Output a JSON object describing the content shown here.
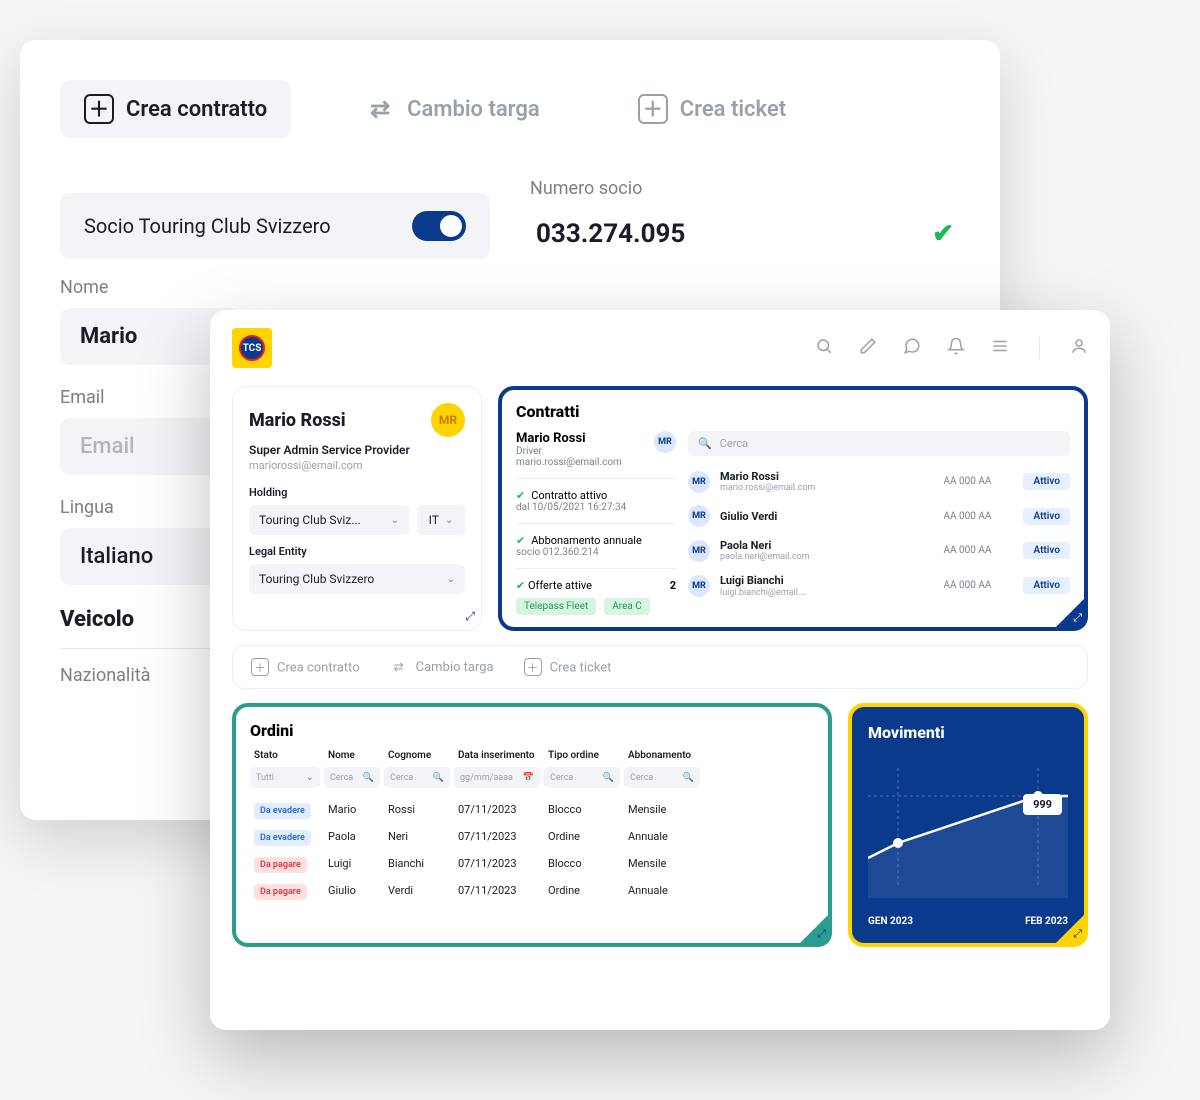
{
  "back": {
    "toolbar": {
      "create_contract": "Crea contratto",
      "change_plate": "Cambio targa",
      "create_ticket": "Crea ticket"
    },
    "member_label": "Socio Touring Club Svizzero",
    "number_label": "Numero socio",
    "number_value": "033.274.095",
    "name_label": "Nome",
    "name_value": "Mario",
    "email_label": "Email",
    "email_placeholder": "Email",
    "lang_label": "Lingua",
    "lang_value": "Italiano",
    "vehicle_heading": "Veicolo",
    "nationality_label": "Nazionalità"
  },
  "front": {
    "user": {
      "name": "Mario Rossi",
      "initials": "MR",
      "role": "Super Admin Service Provider",
      "email": "mariorossi@email.com",
      "holding_label": "Holding",
      "holding_value": "Touring Club Sviz...",
      "country": "IT",
      "legal_label": "Legal Entity",
      "legal_value": "Touring Club Svizzero"
    },
    "contracts": {
      "title": "Contratti",
      "driver_name": "Mario Rossi",
      "driver_role": "Driver",
      "driver_email": "mario.rossi@email.com",
      "status_active": "Contratto attivo",
      "status_date": "dal 10/05/2021 16:27:34",
      "sub_label": "Abbonamento annuale",
      "sub_socio": "socio 012.360.214",
      "offers_label": "Offerte attive",
      "offers_count": "2",
      "tag1": "Telepass Fleet",
      "tag2": "Area C",
      "search_placeholder": "Cerca",
      "people": [
        {
          "name": "Mario Rossi",
          "email": "mario.rossi@email.com",
          "code": "AA 000 AA",
          "status": "Attivo",
          "initials": "MR"
        },
        {
          "name": "Giulio Verdi",
          "email": "",
          "code": "AA 000 AA",
          "status": "Attivo",
          "initials": "MR"
        },
        {
          "name": "Paola Neri",
          "email": "paola.neri@email.com",
          "code": "AA 000 AA",
          "status": "Attivo",
          "initials": "MR"
        },
        {
          "name": "Luigi Bianchi",
          "email": "luigi.bianchi@email.…",
          "code": "AA 000 AA",
          "status": "Attivo",
          "initials": "MR"
        }
      ]
    },
    "actions": {
      "create_contract": "Crea contratto",
      "change_plate": "Cambio targa",
      "create_ticket": "Crea ticket"
    },
    "orders": {
      "title": "Ordini",
      "headers": {
        "stato": "Stato",
        "nome": "Nome",
        "cognome": "Cognome",
        "data": "Data inserimento",
        "tipo": "Tipo ordine",
        "abb": "Abbonamento"
      },
      "filters": {
        "tutti": "Tutti",
        "cerca": "Cerca",
        "date": "gg/mm/aaaa"
      },
      "rows": [
        {
          "status": "Da evadere",
          "status_cls": "blue",
          "nome": "Mario",
          "cognome": "Rossi",
          "data": "07/11/2023",
          "tipo": "Blocco",
          "abb": "Mensile"
        },
        {
          "status": "Da evadere",
          "status_cls": "blue",
          "nome": "Paola",
          "cognome": "Neri",
          "data": "07/11/2023",
          "tipo": "Ordine",
          "abb": "Annuale"
        },
        {
          "status": "Da pagare",
          "status_cls": "red",
          "nome": "Luigi",
          "cognome": "Bianchi",
          "data": "07/11/2023",
          "tipo": "Blocco",
          "abb": "Mensile"
        },
        {
          "status": "Da pagare",
          "status_cls": "red",
          "nome": "Giulio",
          "cognome": "Verdi",
          "data": "07/11/2023",
          "tipo": "Ordine",
          "abb": "Annuale"
        }
      ]
    },
    "movements": {
      "title": "Movimenti",
      "value": "999",
      "x1": "GEN 2023",
      "x2": "FEB 2023"
    }
  },
  "chart_data": {
    "type": "line",
    "categories": [
      "GEN 2023",
      "FEB 2023"
    ],
    "values": [
      650,
      999
    ],
    "title": "Movimenti",
    "xlabel": "",
    "ylabel": "",
    "ylim": [
      0,
      1000
    ]
  }
}
